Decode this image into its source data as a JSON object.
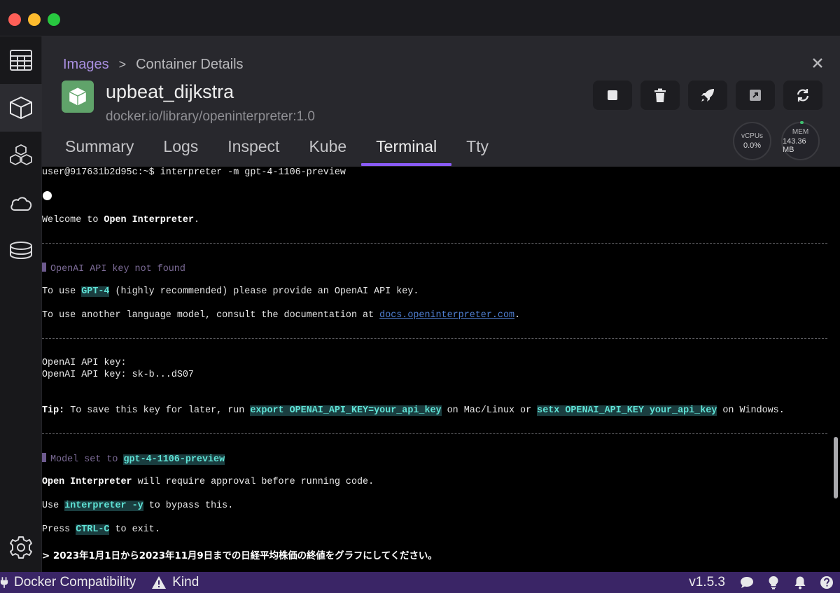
{
  "window": {
    "traffic_lights": [
      "close",
      "minimize",
      "maximize"
    ]
  },
  "nav": {
    "items": [
      {
        "name": "dashboard-icon"
      },
      {
        "name": "containers-icon",
        "active": true
      },
      {
        "name": "pods-icon"
      },
      {
        "name": "images-icon"
      },
      {
        "name": "volumes-icon"
      },
      {
        "name": "settings-icon"
      }
    ]
  },
  "breadcrumb": {
    "parent": "Images",
    "separator": ">",
    "current": "Container Details"
  },
  "container": {
    "name": "upbeat_dijkstra",
    "image": "docker.io/library/openinterpreter:1.0"
  },
  "actions": [
    "stop-icon",
    "delete-icon",
    "deploy-icon",
    "open-browser-icon",
    "restart-icon"
  ],
  "stats": {
    "cpu_label": "vCPUs",
    "cpu_value": "0.0%",
    "mem_label": "MEM",
    "mem_value": "143.36 MB"
  },
  "tabs": [
    "Summary",
    "Logs",
    "Inspect",
    "Kube",
    "Terminal",
    "Tty"
  ],
  "active_tab": "Terminal",
  "terminal": {
    "prompt": "user@917631b2d95c:~$ interpreter -m gpt-4-1106-preview",
    "welcome_pre": "Welcome to ",
    "welcome_bold": "Open Interpreter",
    "welcome_post": ".",
    "warn_title": "OpenAI API key not found",
    "line1_pre": "To use ",
    "line1_hl": "GPT-4",
    "line1_post": " (highly recommended) please provide an OpenAI API key.",
    "line2_pre": "To use another language model, consult the documentation at ",
    "line2_link": "docs.openinterpreter.com",
    "line2_post": ".",
    "key_prompt": "OpenAI API key:",
    "key_value": "OpenAI API key: sk-b...dS07",
    "tip_label": "Tip:",
    "tip_pre": " To save this key for later, run ",
    "tip_cmd1": "export OPENAI_API_KEY=your_api_key",
    "tip_mid": " on Mac/Linux or ",
    "tip_cmd2": "setx OPENAI_API_KEY your_api_key",
    "tip_post": " on Windows.",
    "model_pre": "Model set to ",
    "model_hl": "gpt-4-1106-preview",
    "approval_bold": "Open Interpreter",
    "approval_post": " will require approval before running code.",
    "use_pre": "Use ",
    "use_hl": "interpreter -y",
    "use_post": " to bypass this.",
    "press_pre": "Press ",
    "press_hl": "CTRL-C",
    "press_post": " to exit.",
    "input": "> 2023年1月1日から2023年11月9日までの日経平均株価の終値をグラフにしてください。"
  },
  "statusbar": {
    "docker_compat": "Docker Compatibility",
    "kind": "Kind",
    "version": "v1.5.3"
  }
}
